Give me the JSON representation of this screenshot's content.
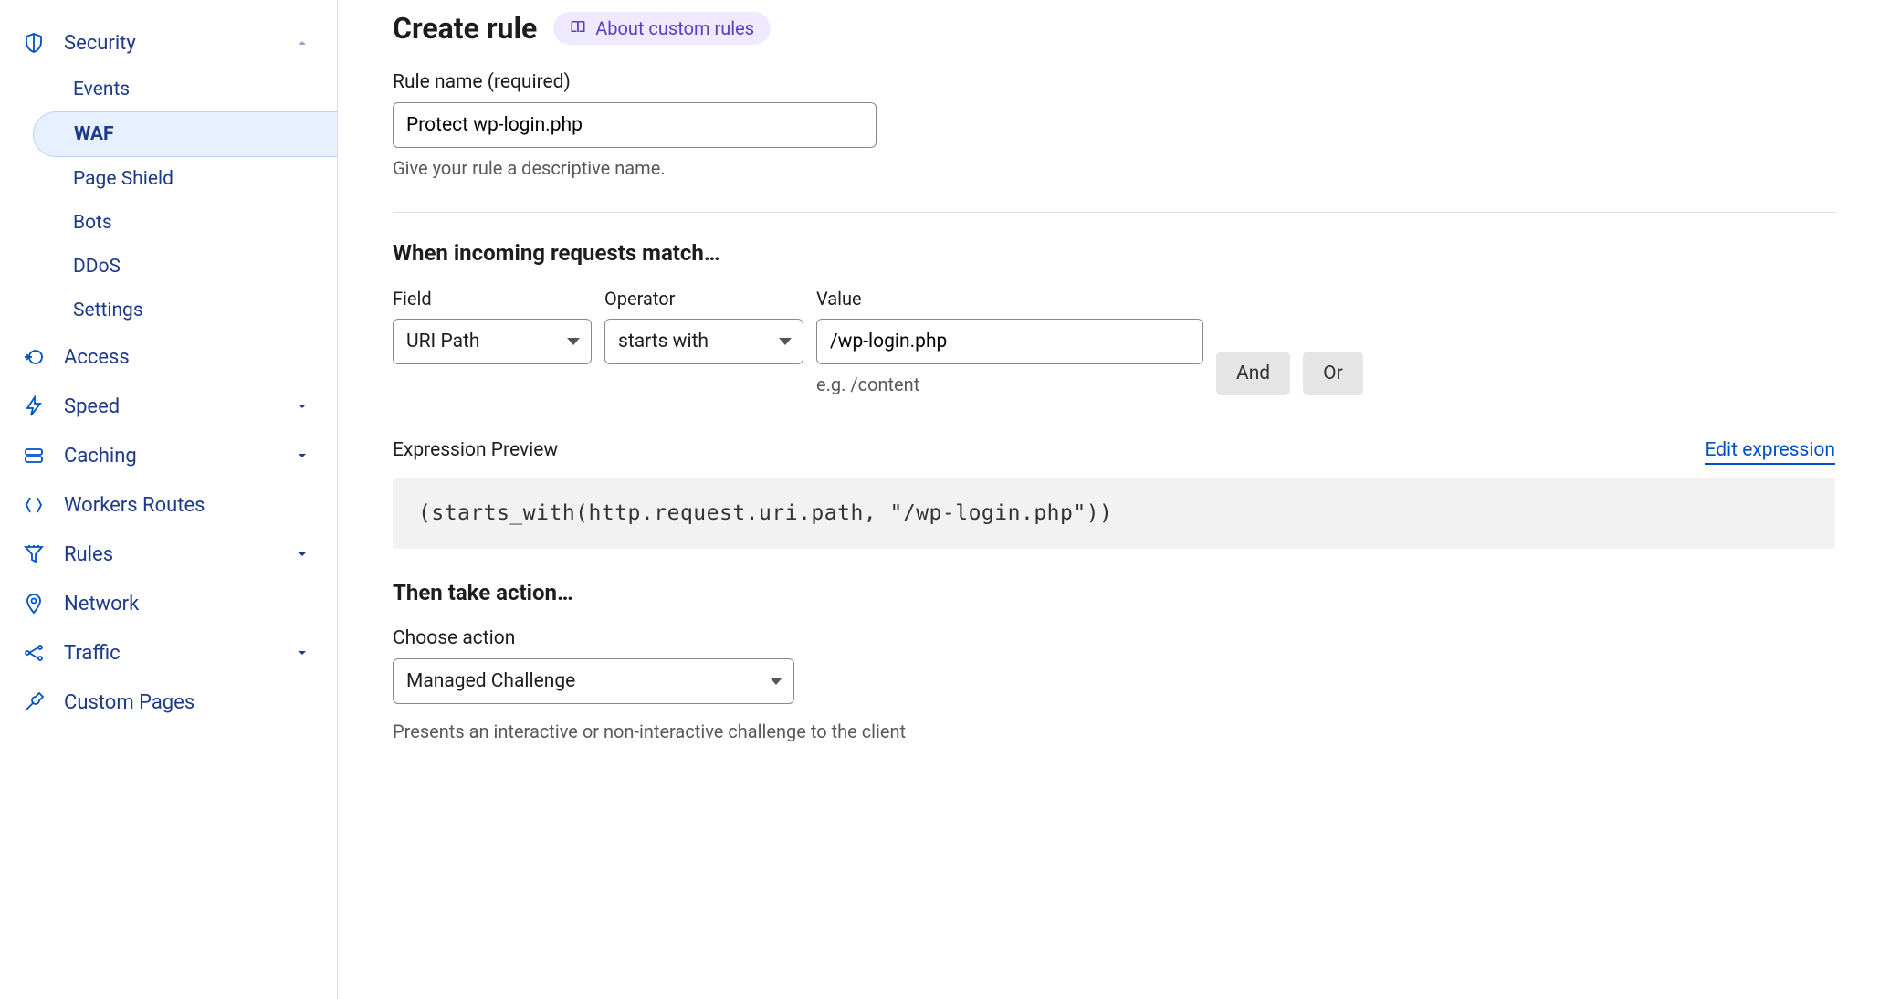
{
  "sidebar": {
    "security": {
      "label": "Security",
      "expanded": true,
      "items": [
        {
          "label": "Events",
          "active": false
        },
        {
          "label": "WAF",
          "active": true
        },
        {
          "label": "Page Shield",
          "active": false
        },
        {
          "label": "Bots",
          "active": false
        },
        {
          "label": "DDoS",
          "active": false
        },
        {
          "label": "Settings",
          "active": false
        }
      ]
    },
    "access": {
      "label": "Access"
    },
    "speed": {
      "label": "Speed"
    },
    "caching": {
      "label": "Caching"
    },
    "workers_routes": {
      "label": "Workers Routes"
    },
    "rules": {
      "label": "Rules"
    },
    "network": {
      "label": "Network"
    },
    "traffic": {
      "label": "Traffic"
    },
    "custom_pages": {
      "label": "Custom Pages"
    }
  },
  "header": {
    "title": "Create rule",
    "about_label": "About custom rules"
  },
  "rule_name": {
    "label": "Rule name (required)",
    "value": "Protect wp-login.php",
    "hint": "Give your rule a descriptive name."
  },
  "match": {
    "section_title": "When incoming requests match…",
    "field_label": "Field",
    "field_value": "URI Path",
    "operator_label": "Operator",
    "operator_value": "starts with",
    "value_label": "Value",
    "value_value": "/wp-login.php",
    "value_example": "e.g. /content",
    "and_label": "And",
    "or_label": "Or"
  },
  "preview": {
    "label": "Expression Preview",
    "edit_label": "Edit expression",
    "code": "(starts_with(http.request.uri.path, \"/wp-login.php\"))"
  },
  "action": {
    "section_title": "Then take action…",
    "choose_label": "Choose action",
    "value": "Managed Challenge",
    "description": "Presents an interactive or non-interactive challenge to the client"
  }
}
